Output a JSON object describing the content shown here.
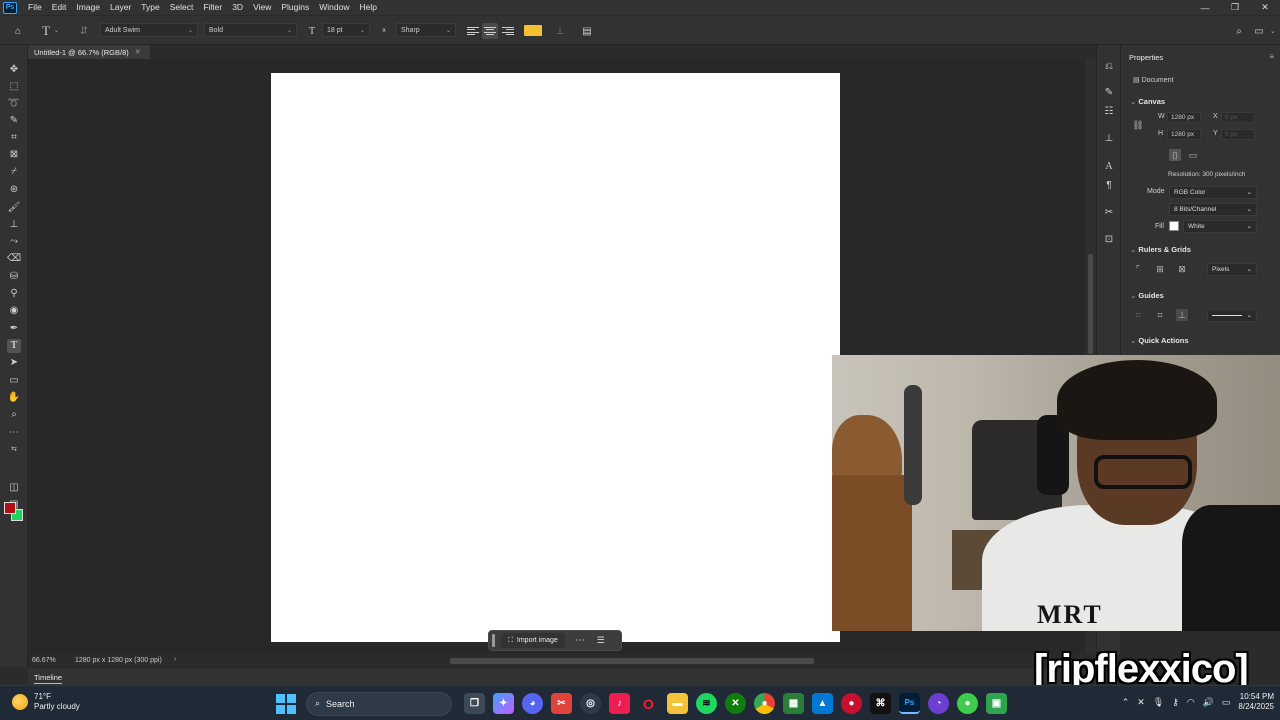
{
  "app": {
    "logo": "Ps",
    "menu": [
      "File",
      "Edit",
      "Image",
      "Layer",
      "Type",
      "Select",
      "Filter",
      "3D",
      "View",
      "Plugins",
      "Window",
      "Help"
    ]
  },
  "options": {
    "font_family": "Adult Swim",
    "font_style": "Bold",
    "font_size": "18 pt",
    "anti_alias": "Sharp",
    "text_color": "#f5c131"
  },
  "document": {
    "tab_title": "Untitled-1 @ 66.7% (RGB/8)",
    "zoom": "66.67%",
    "dims": "1280 px x 1280 px (300 ppi)"
  },
  "timeline": {
    "label": "Timeline"
  },
  "context_bar": {
    "import_label": "Import image"
  },
  "colors": {
    "foreground": "#b40f15",
    "background": "#1ed45a"
  },
  "properties": {
    "title": "Properties",
    "document_label": "Document",
    "canvas_head": "Canvas",
    "w_label": "W",
    "w_value": "1280 px",
    "h_label": "H",
    "h_value": "1280 px",
    "x_label": "X",
    "x_value": "0 px",
    "y_label": "Y",
    "y_value": "0 px",
    "resolution": "Resolution: 300 pixels/inch",
    "mode_label": "Mode",
    "mode_value": "RGB Color",
    "bits_value": "8 Bits/Channel",
    "fill_label": "Fill",
    "fill_value": "White",
    "rulers_head": "Rulers & Grids",
    "units_value": "Pixels",
    "guides_head": "Guides",
    "quick_head": "Quick Actions"
  },
  "overlay": {
    "shirt_text": "MRT",
    "watermark": "[ripflexxico]"
  },
  "taskbar": {
    "weather_temp": "71°F",
    "weather_desc": "Partly cloudy",
    "search_label": "Search",
    "time": "10:54 PM",
    "date": "8/24/2025"
  }
}
